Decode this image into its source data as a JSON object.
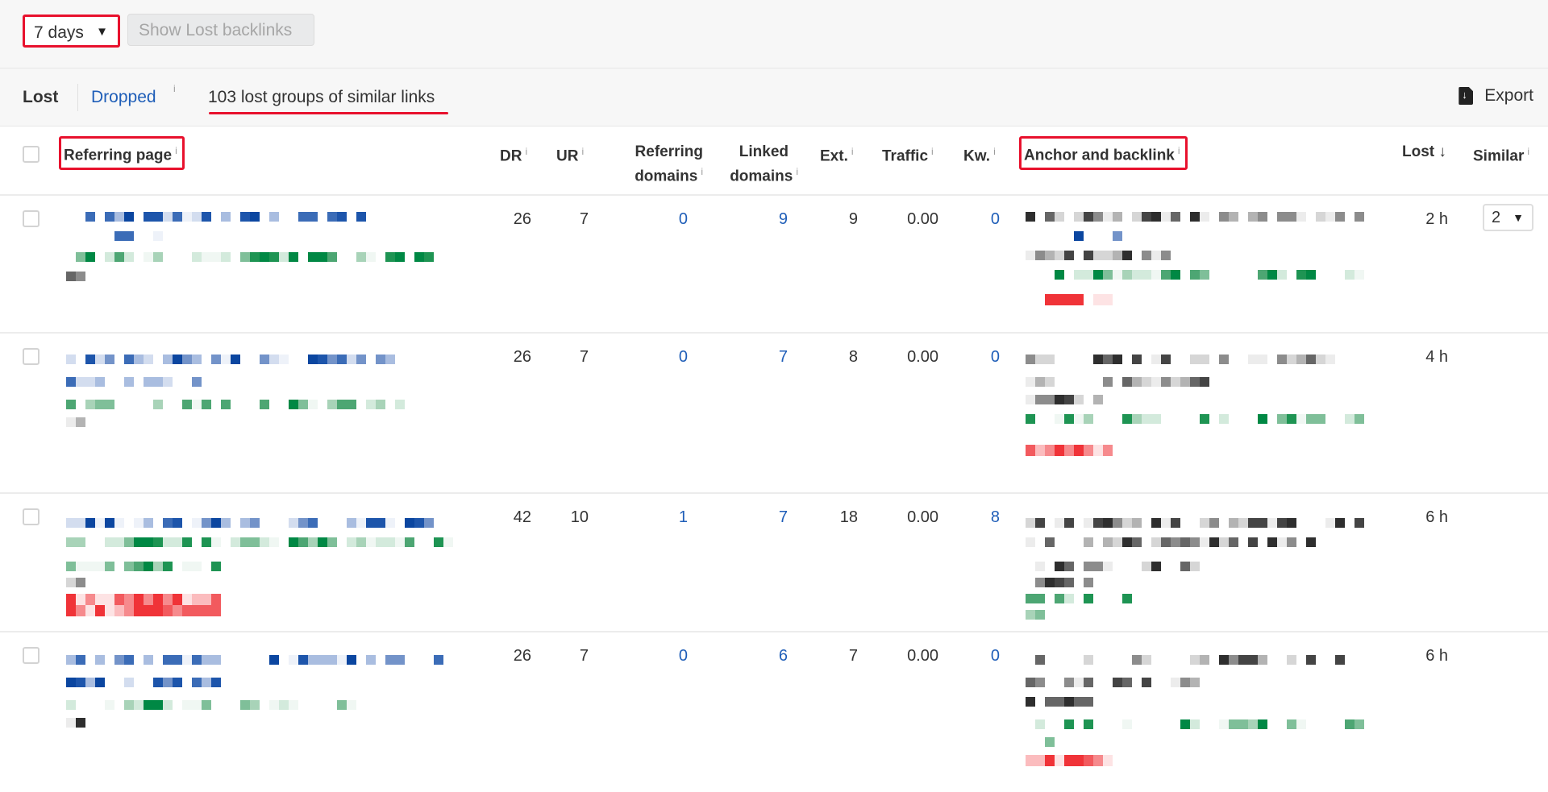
{
  "filters": {
    "period_select": "7 days",
    "show_lost_button": "Show Lost backlinks"
  },
  "tabs": {
    "lost": "Lost",
    "dropped": "Dropped",
    "info_marker": "i",
    "groups_summary": "103 lost groups of similar links",
    "export": "Export"
  },
  "columns": {
    "referring_page": "Referring page",
    "dr": "DR",
    "ur": "UR",
    "referring_domains_1": "Referring",
    "referring_domains_2": "domains",
    "linked_domains_1": "Linked",
    "linked_domains_2": "domains",
    "ext": "Ext.",
    "traffic": "Traffic",
    "kw": "Kw.",
    "anchor_backlink": "Anchor and backlink",
    "lost": "Lost",
    "lost_sort_icon": "↓",
    "similar": "Similar"
  },
  "colors": {
    "highlight_red": "#e8112d",
    "link_blue": "#1f5eb8",
    "redacted_blue": "#0b46a0",
    "redacted_green": "#008844",
    "redacted_dark": "#333333",
    "redacted_red": "#f03338"
  },
  "rows": [
    {
      "referring_page": "[redacted]",
      "dr": "26",
      "ur": "7",
      "referring_domains": "0",
      "linked_domains": "9",
      "ext": "9",
      "traffic": "0.00",
      "kw": "0",
      "anchor_backlink": "[redacted]",
      "lost": "2 h",
      "similar": "2"
    },
    {
      "referring_page": "[redacted]",
      "dr": "26",
      "ur": "7",
      "referring_domains": "0",
      "linked_domains": "7",
      "ext": "8",
      "traffic": "0.00",
      "kw": "0",
      "anchor_backlink": "[redacted]",
      "lost": "4 h",
      "similar": ""
    },
    {
      "referring_page": "[redacted]",
      "dr": "42",
      "ur": "10",
      "referring_domains": "1",
      "linked_domains": "7",
      "ext": "18",
      "traffic": "0.00",
      "kw": "8",
      "anchor_backlink": "[redacted]",
      "lost": "6 h",
      "similar": ""
    },
    {
      "referring_page": "[redacted]",
      "dr": "26",
      "ur": "7",
      "referring_domains": "0",
      "linked_domains": "6",
      "ext": "7",
      "traffic": "0.00",
      "kw": "0",
      "anchor_backlink": "[redacted]",
      "lost": "6 h",
      "similar": ""
    }
  ]
}
